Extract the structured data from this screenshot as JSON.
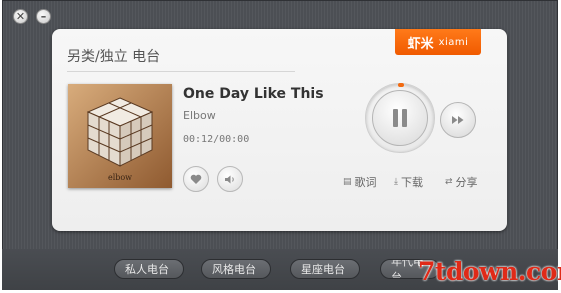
{
  "window": {
    "close_glyph": "✕",
    "minimize_glyph": "–"
  },
  "channel": {
    "title": "另类/独立 电台"
  },
  "logo": {
    "cn": "虾米",
    "en": "xiami",
    "color": "#f26a10"
  },
  "track": {
    "title": "One Day Like This",
    "artist": "Elbow",
    "time": "00:12/00:00",
    "album_art_label": "elbow"
  },
  "controls": {
    "like_icon": "heart-icon",
    "volume_icon": "speaker-icon",
    "play_state": "paused",
    "next_icon": "fast-forward-icon"
  },
  "actions": {
    "lyrics": "歌词",
    "download": "下载",
    "share": "分享"
  },
  "bottom_tabs": [
    "私人电台",
    "风格电台",
    "星座电台",
    "年代电台"
  ],
  "watermark": {
    "text": "7tdown.com",
    "color": "#e02a18"
  }
}
